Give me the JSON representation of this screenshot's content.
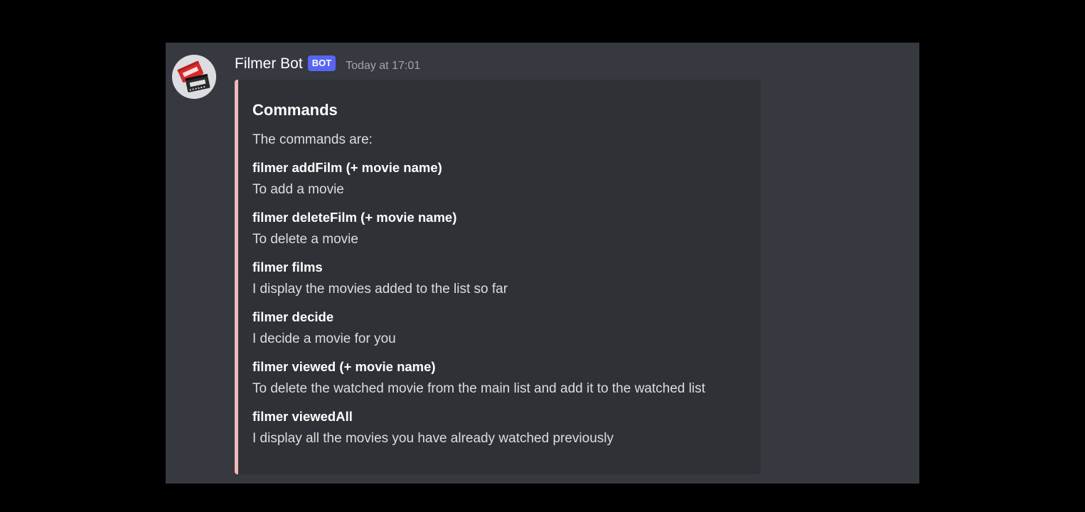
{
  "message": {
    "username": "Filmer Bot",
    "bot_tag": "BOT",
    "timestamp": "Today at 17:01",
    "avatar_icon": "filmer-ticket-logo-icon",
    "embed": {
      "accent_color": "#f0b8b8",
      "title": "Commands",
      "description": "The commands are:",
      "fields": [
        {
          "name": "filmer addFilm (+ movie name)",
          "value": "To add a movie"
        },
        {
          "name": "filmer deleteFilm (+ movie name)",
          "value": "To delete a movie"
        },
        {
          "name": "filmer films",
          "value": "I display the movies added to the list so far"
        },
        {
          "name": "filmer decide",
          "value": "I decide a movie for you"
        },
        {
          "name": "filmer viewed (+ movie name)",
          "value": "To delete the watched movie from the main list and add it to the watched list"
        },
        {
          "name": "filmer viewedAll",
          "value": "I display all the movies you have already watched previously"
        }
      ]
    }
  },
  "colors": {
    "page_background": "#000000",
    "panel_background": "#36393f",
    "embed_background": "#2f3136",
    "bot_tag_background": "#5865f2"
  }
}
